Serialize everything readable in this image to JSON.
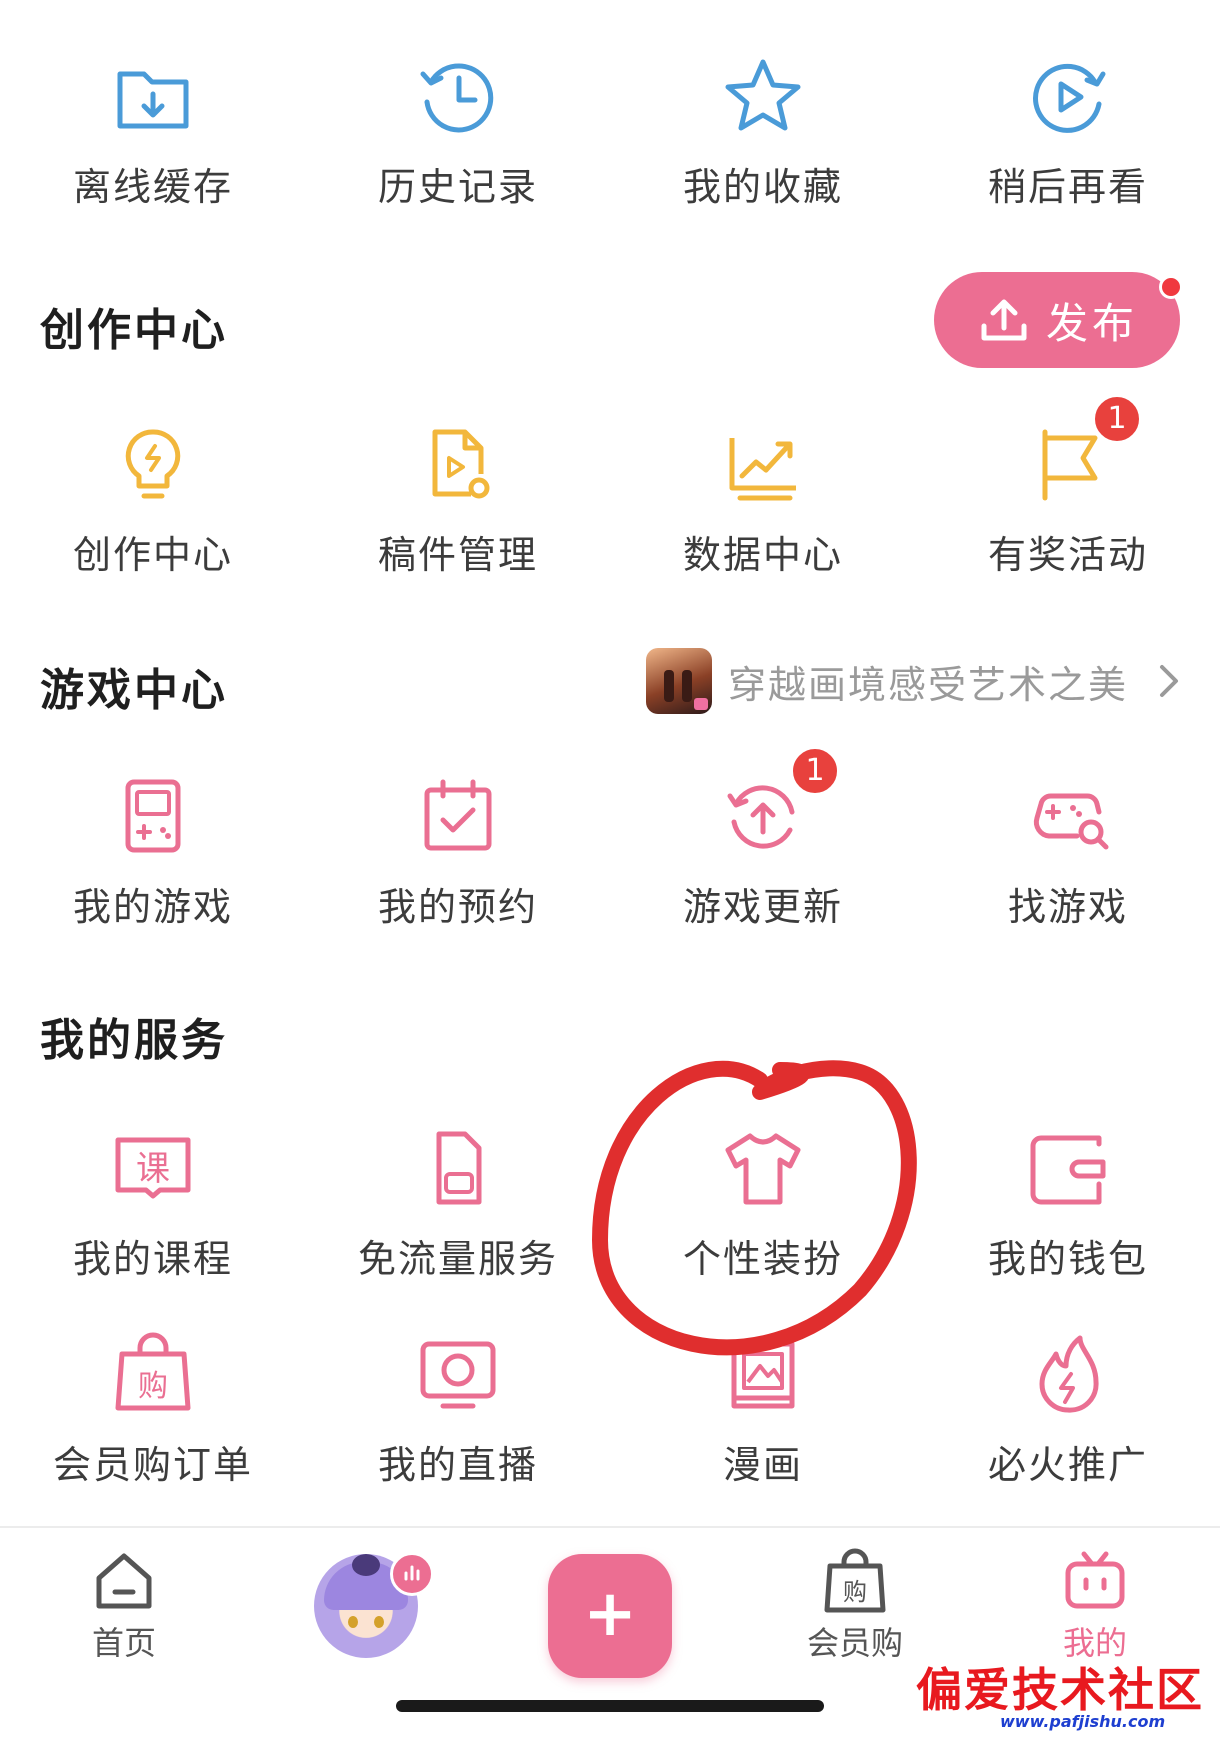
{
  "top_row": [
    {
      "label": "离线缓存",
      "icon": "download-folder-icon"
    },
    {
      "label": "历史记录",
      "icon": "history-clock-icon"
    },
    {
      "label": "我的收藏",
      "icon": "star-icon"
    },
    {
      "label": "稍后再看",
      "icon": "play-later-icon"
    }
  ],
  "creation": {
    "title": "创作中心",
    "publish_label": "发布",
    "items": [
      {
        "label": "创作中心",
        "icon": "lightbulb-icon"
      },
      {
        "label": "稿件管理",
        "icon": "manuscript-icon"
      },
      {
        "label": "数据中心",
        "icon": "chart-icon"
      },
      {
        "label": "有奖活动",
        "icon": "flag-icon",
        "badge": "1"
      }
    ]
  },
  "game": {
    "title": "游戏中心",
    "promo_text": "穿越画境感受艺术之美",
    "items": [
      {
        "label": "我的游戏",
        "icon": "gameboy-icon"
      },
      {
        "label": "我的预约",
        "icon": "calendar-check-icon"
      },
      {
        "label": "游戏更新",
        "icon": "update-icon",
        "badge": "1"
      },
      {
        "label": "找游戏",
        "icon": "gamepad-search-icon"
      }
    ]
  },
  "services": {
    "title": "我的服务",
    "items": [
      {
        "label": "我的课程",
        "icon": "course-book-icon",
        "glyph": "课"
      },
      {
        "label": "免流量服务",
        "icon": "sim-card-icon"
      },
      {
        "label": "个性装扮",
        "icon": "tshirt-icon"
      },
      {
        "label": "我的钱包",
        "icon": "wallet-icon"
      },
      {
        "label": "会员购订单",
        "icon": "shopping-bag-icon",
        "glyph": "购"
      },
      {
        "label": "我的直播",
        "icon": "live-tv-icon"
      },
      {
        "label": "漫画",
        "icon": "comic-book-icon"
      },
      {
        "label": "必火推广",
        "icon": "fire-icon"
      }
    ]
  },
  "tabbar": {
    "home": "首页",
    "plus": "+",
    "mall": "会员购",
    "mall_glyph": "购",
    "mine": "我的"
  },
  "watermark": {
    "text": "偏爱技术社区",
    "url": "www.pafjishu.com"
  },
  "colors": {
    "blue": "#4a9bd8",
    "yellow": "#f2b73c",
    "pink": "#ea6f92",
    "red": "#e8413d",
    "annotation": "#e02e2e"
  }
}
